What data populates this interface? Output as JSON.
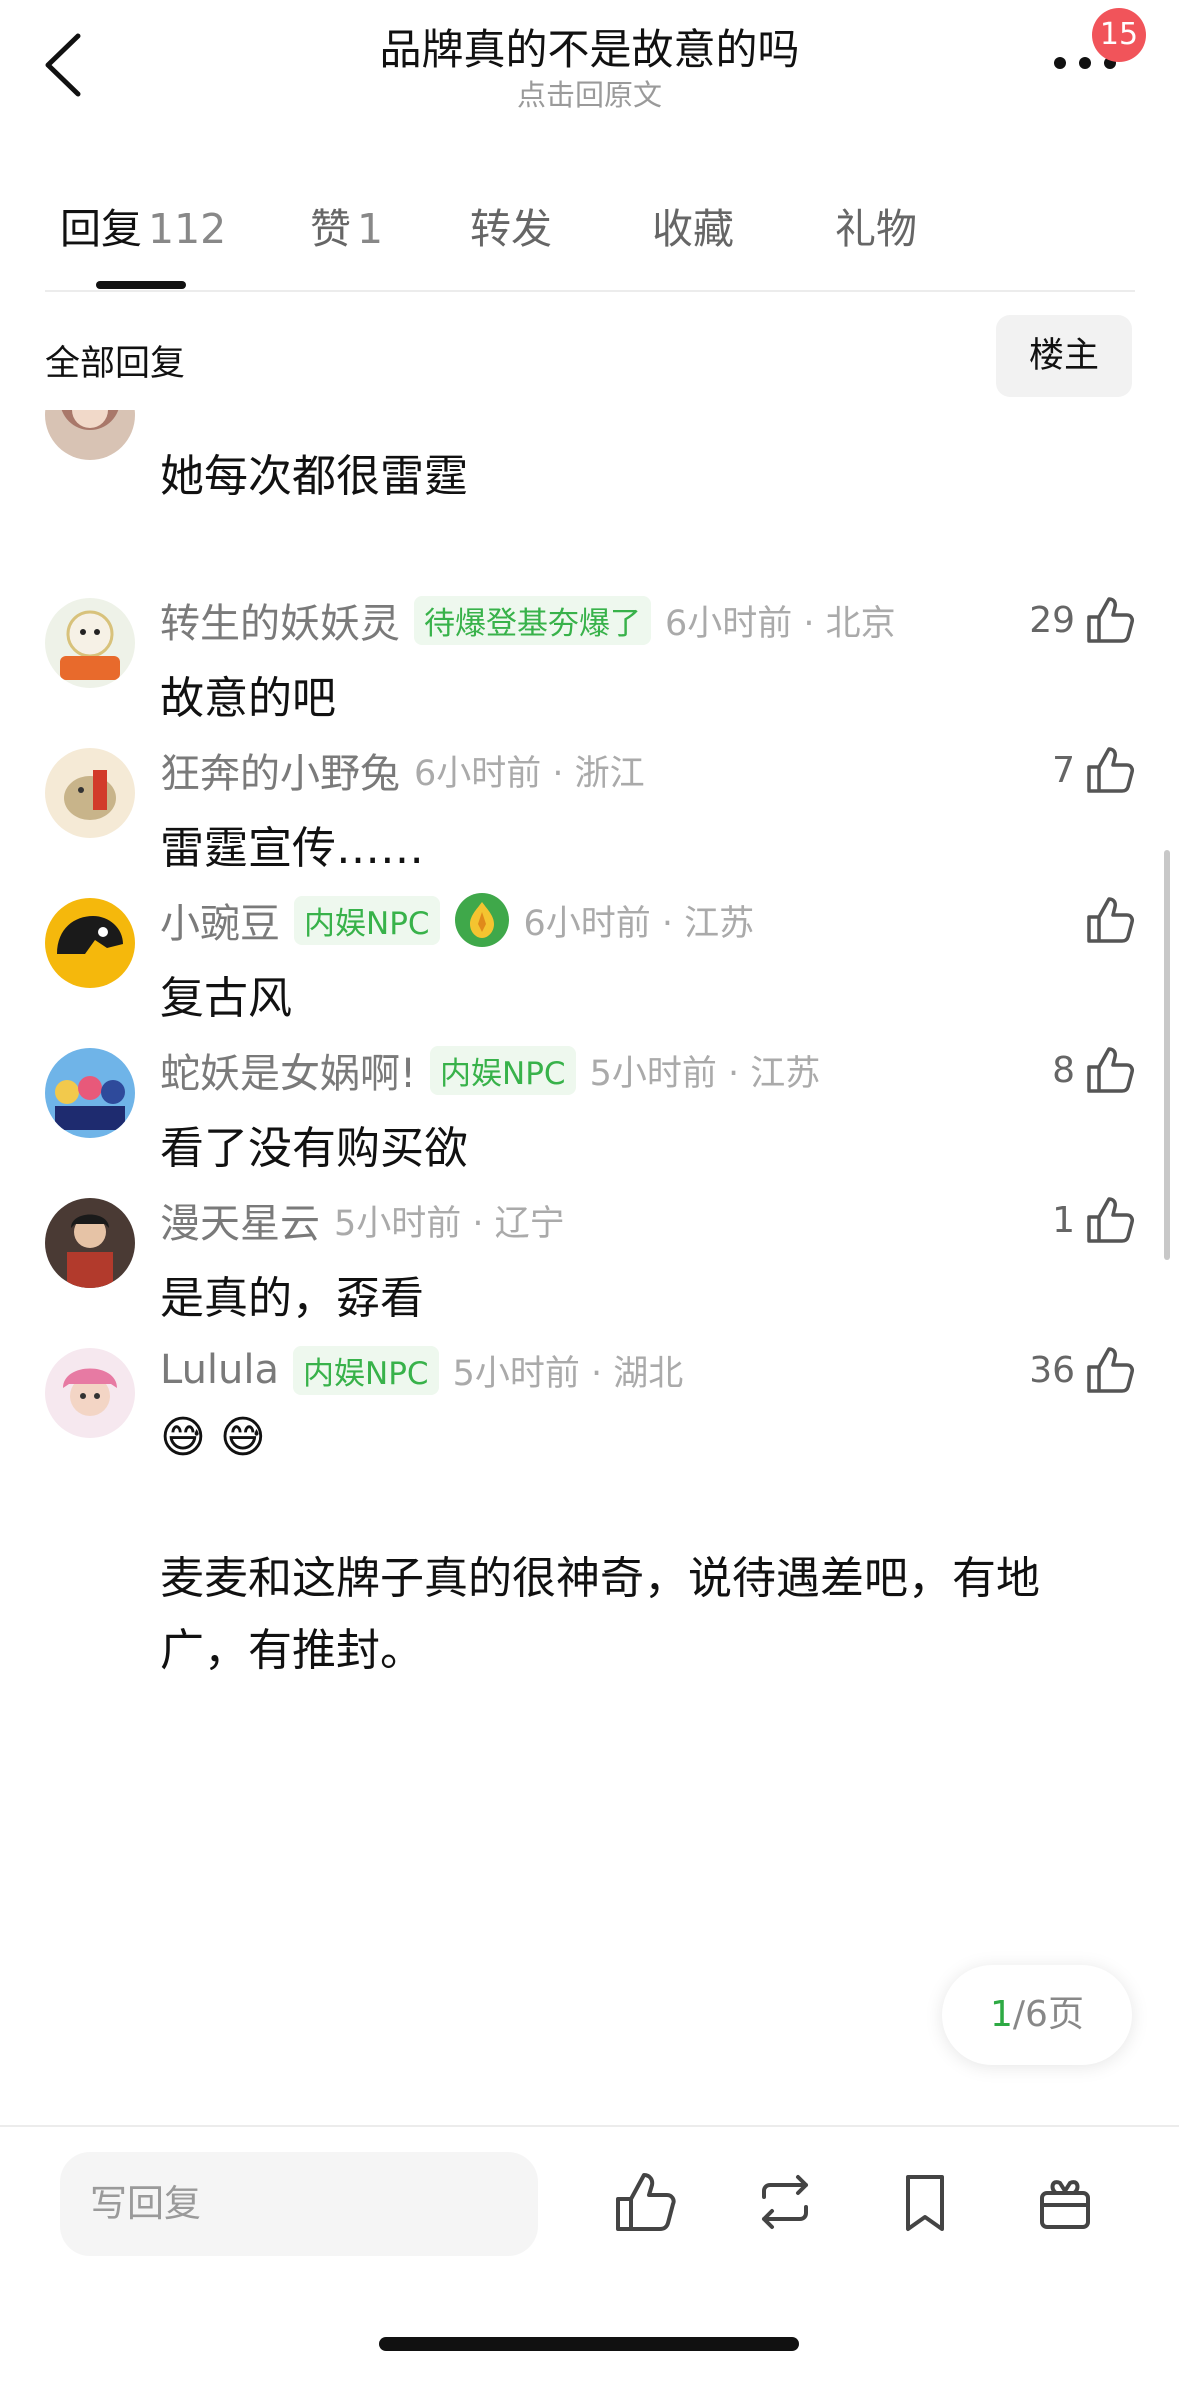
{
  "header": {
    "title": "品牌真的不是故意的吗",
    "subtitle": "点击回原文",
    "notification_count": "15"
  },
  "tabs": [
    {
      "label": "回复",
      "count": "112"
    },
    {
      "label": "赞",
      "count": "1"
    },
    {
      "label": "转发",
      "count": ""
    },
    {
      "label": "收藏",
      "count": ""
    },
    {
      "label": "礼物",
      "count": ""
    }
  ],
  "filter": {
    "all_replies": "全部回复",
    "op_only": "楼主"
  },
  "partial_comment": {
    "content": "她每次都很雷霆"
  },
  "comments": [
    {
      "username": "转生的妖妖灵",
      "tag": "待爆登基夯爆了",
      "time": "6小时前 · 北京",
      "content": "故意的吧",
      "likes": "29"
    },
    {
      "username": "狂奔的小野兔",
      "tag": "",
      "time": "6小时前 · 浙江",
      "content": "雷霆宣传……",
      "likes": "7"
    },
    {
      "username": "小豌豆",
      "tag": "内娱NPC",
      "time": "6小时前 · 江苏",
      "content": "复古风",
      "likes": ""
    },
    {
      "username": "蛇妖是女娲啊!",
      "tag": "内娱NPC",
      "time": "5小时前 · 江苏",
      "content": "看了没有购买欲",
      "likes": "8"
    },
    {
      "username": "漫天星云",
      "tag": "",
      "time": "5小时前 · 辽宁",
      "content": "是真的，孬看",
      "likes": "1"
    },
    {
      "username": "Lulula",
      "tag": "内娱NPC",
      "time": "5小时前 · 湖北",
      "content": "😅 😅",
      "content2": "麦麦和这牌子真的很神奇，说待遇差吧，有地",
      "content3": "广，有推封。",
      "likes": "36"
    }
  ],
  "pager": {
    "current": "1",
    "total": "/6页"
  },
  "bottom_bar": {
    "reply_placeholder": "写回复"
  }
}
